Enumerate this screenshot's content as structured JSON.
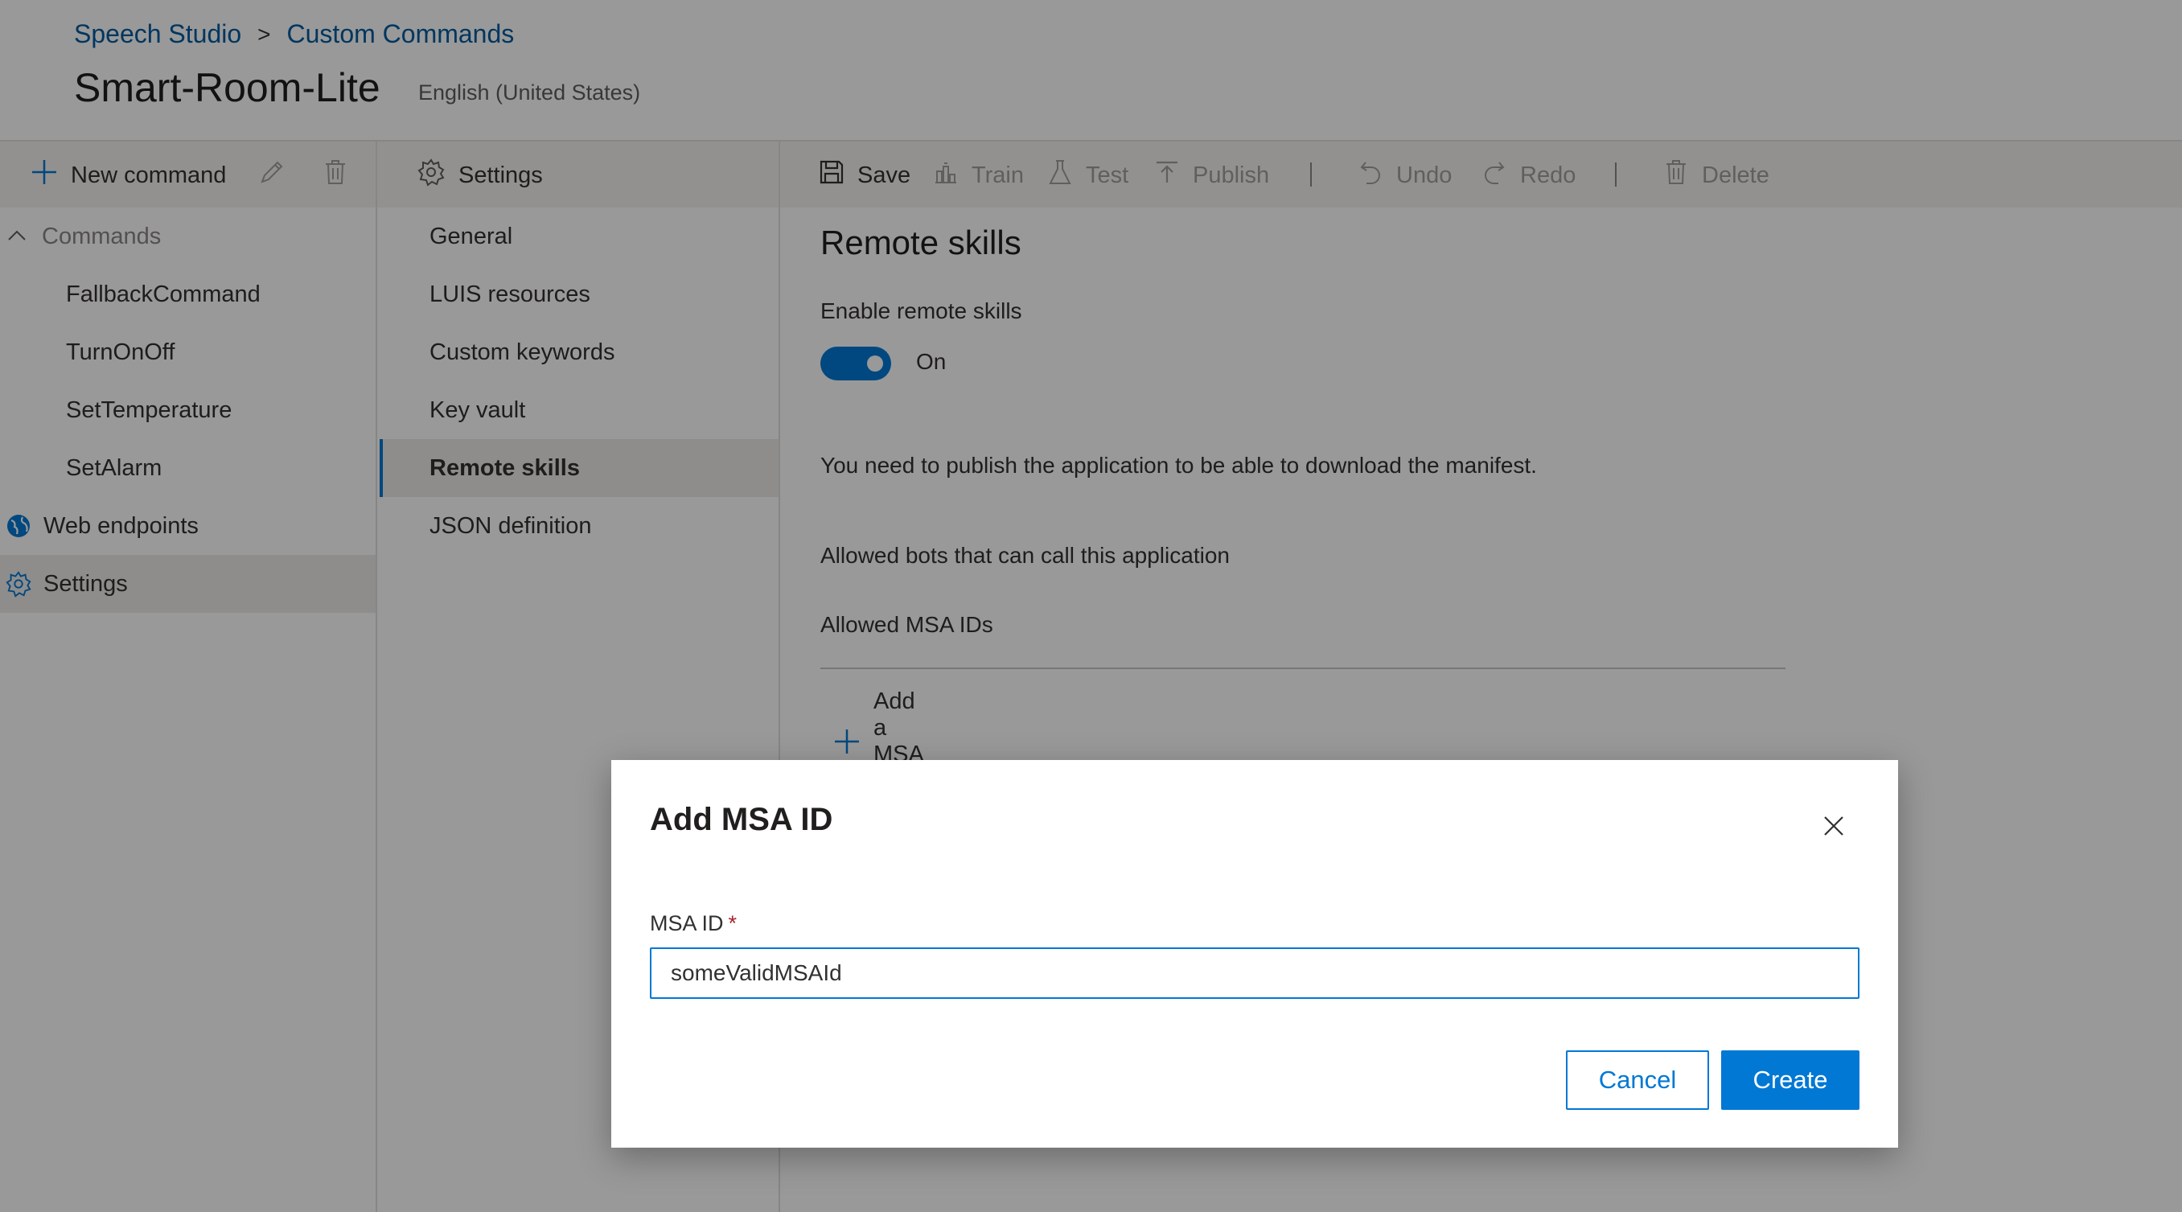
{
  "breadcrumb": {
    "root": "Speech Studio",
    "separator": ">",
    "current": "Custom Commands"
  },
  "app": {
    "title": "Smart-Room-Lite",
    "language": "English (United States)"
  },
  "left_toolbar": {
    "new_command": "New command"
  },
  "mid_toolbar": {
    "settings": "Settings"
  },
  "toolbar": {
    "save": "Save",
    "train": "Train",
    "test": "Test",
    "publish": "Publish",
    "undo": "Undo",
    "redo": "Redo",
    "delete": "Delete"
  },
  "sidebar": {
    "commands_header": "Commands",
    "commands": [
      "FallbackCommand",
      "TurnOnOff",
      "SetTemperature",
      "SetAlarm"
    ],
    "web_endpoints": "Web endpoints",
    "settings": "Settings"
  },
  "settings_nav": {
    "items": [
      "General",
      "LUIS resources",
      "Custom keywords",
      "Key vault",
      "Remote skills",
      "JSON definition"
    ],
    "selected": "Remote skills"
  },
  "main": {
    "title": "Remote skills",
    "enable_label": "Enable remote skills",
    "toggle_state": "On",
    "publish_note": "You need to publish the application to be able to download the manifest.",
    "allowed_bots": "Allowed bots that can call this application",
    "allowed_msa_ids": "Allowed MSA IDs",
    "add_msa_id": "Add a MSA ID"
  },
  "dialog": {
    "title": "Add MSA ID",
    "field_label": "MSA ID",
    "required_mark": "*",
    "field_value": "someValidMSAId",
    "cancel": "Cancel",
    "create": "Create"
  },
  "colors": {
    "accent": "#0078d4",
    "link": "#005a9e",
    "required": "#a4262c"
  }
}
